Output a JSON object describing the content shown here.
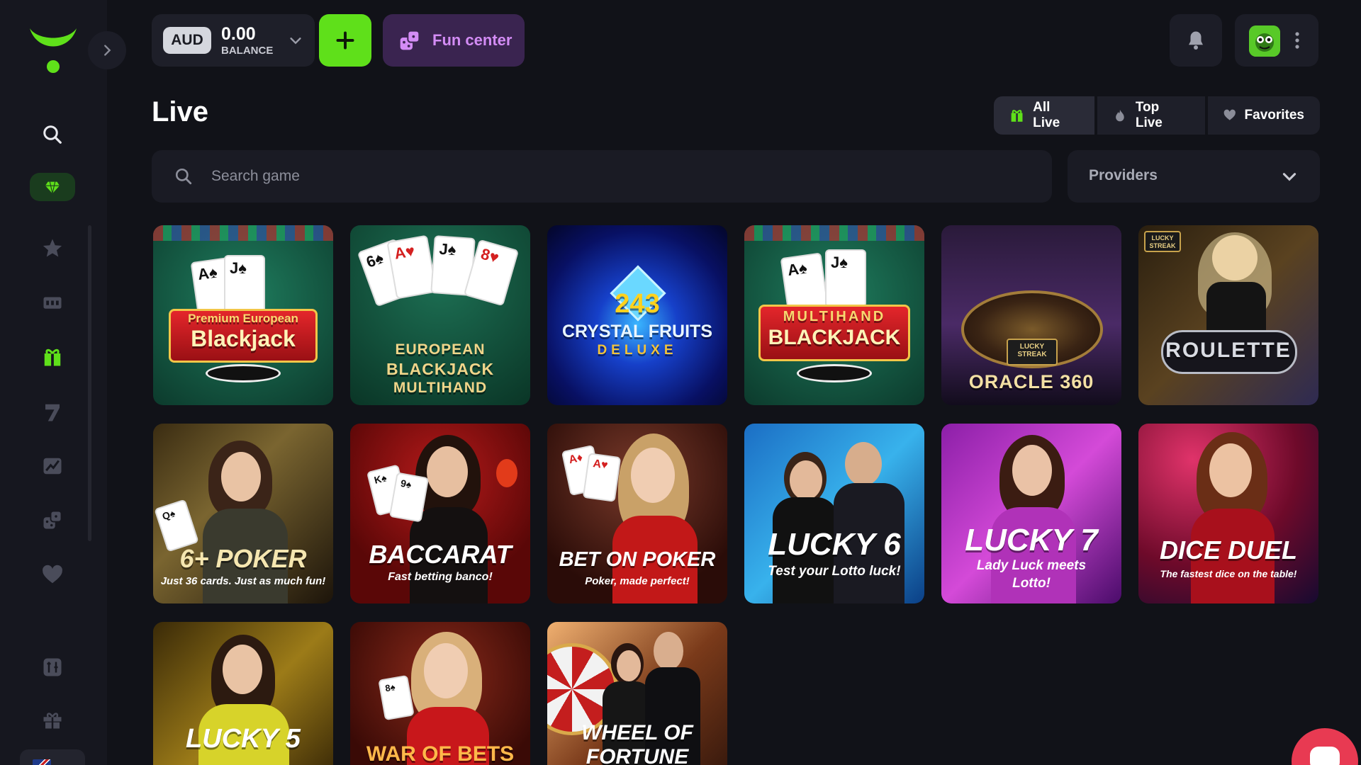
{
  "balance": {
    "currency": "AUD",
    "amount": "0.00",
    "label": "BALANCE"
  },
  "fun_center": {
    "label": "Fun center"
  },
  "page": {
    "title": "Live"
  },
  "filters": {
    "all_live": "All Live",
    "top_live": "Top Live",
    "favorites": "Favorites"
  },
  "search": {
    "placeholder": "Search game"
  },
  "providers": {
    "label": "Providers"
  },
  "colors": {
    "accent_green": "#5fe01a",
    "fun_purple": "#d38cf5",
    "chat_red": "#e83a52",
    "background": "#111218"
  },
  "sidebar_icons": [
    "search-icon",
    "gem-icon",
    "star-icon",
    "ticket-icon",
    "gift-icon",
    "seven-icon",
    "trend-icon",
    "dice-icon",
    "heart-icon",
    "joystick-icon",
    "present-icon"
  ],
  "games": [
    {
      "title_top": "Premium European",
      "title": "Blackjack",
      "subtitle": ""
    },
    {
      "title_top": "EUROPEAN",
      "title": "BLACKJACK",
      "subtitle": "MULTIHAND"
    },
    {
      "title_top": "243",
      "title": "CRYSTAL FRUITS",
      "subtitle": "DELUXE"
    },
    {
      "title_top": "MULTIHAND",
      "title": "BLACKJACK",
      "subtitle": ""
    },
    {
      "title_top": "LUCKY STREAK",
      "title": "ORACLE 360",
      "subtitle": ""
    },
    {
      "title_top": "LUCKY STREAK",
      "title": "ROULETTE",
      "subtitle": ""
    },
    {
      "title_top": "",
      "title": "6+ POKER",
      "subtitle": "Just 36 cards. Just as much fun!"
    },
    {
      "title_top": "",
      "title": "BACCARAT",
      "subtitle": "Fast betting banco!"
    },
    {
      "title_top": "",
      "title": "BET ON POKER",
      "subtitle": "Poker, made perfect!"
    },
    {
      "title_top": "",
      "title": "LUCKY 6",
      "subtitle": "Test your Lotto luck!"
    },
    {
      "title_top": "",
      "title": "LUCKY 7",
      "subtitle": "Lady Luck meets Lotto!"
    },
    {
      "title_top": "",
      "title": "DICE DUEL",
      "subtitle": "The fastest dice on the table!"
    },
    {
      "title_top": "",
      "title": "LUCKY 5",
      "subtitle": ""
    },
    {
      "title_top": "",
      "title": "WAR OF BETS",
      "subtitle": ""
    },
    {
      "title_top": "",
      "title": "WHEEL OF FORTUNE",
      "subtitle": ""
    }
  ]
}
